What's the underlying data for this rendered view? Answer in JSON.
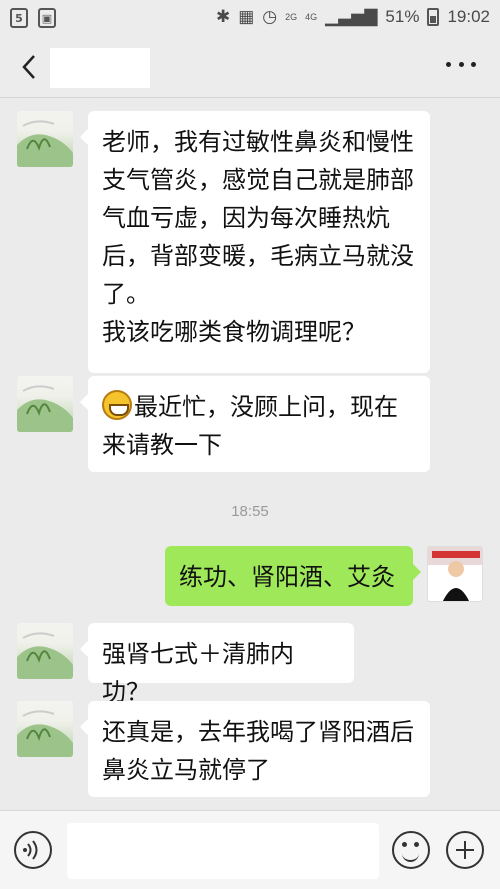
{
  "status_bar": {
    "signal_2g": "2G",
    "signal_4g": "4G",
    "battery": "51%",
    "time": "19:02"
  },
  "nav": {
    "title": "",
    "icons": [
      "back-icon",
      "more-icon"
    ]
  },
  "messages": [
    {
      "side": "left",
      "text": "老师，我有过敏性鼻炎和慢性\n支气管炎，感觉自己就是肺部\n气血亏虚，因为每次睡热炕\n后，背部变暖，毛病立马就没\n了。\n我该吃哪类食物调理呢？"
    },
    {
      "side": "left",
      "text": "最近忙，没顾上问，现在\n来请教一下",
      "emoji": "grinning-face-icon"
    },
    {
      "side": "center",
      "text": "18:55"
    },
    {
      "side": "right",
      "text": "练功、肾阳酒、艾灸"
    },
    {
      "side": "left",
      "text": "强肾七式＋清肺内功？"
    },
    {
      "side": "left",
      "text": "还真是，去年我喝了肾阳酒后\n鼻炎立马就停了"
    }
  ],
  "input": {
    "placeholder": "",
    "icons": [
      "voice-icon",
      "emoji-icon",
      "plus-icon"
    ]
  },
  "colors": {
    "background": "#ebebeb",
    "bubble_received": "#ffffff",
    "bubble_sent": "#9fe85a",
    "timestamp": "#999999"
  }
}
